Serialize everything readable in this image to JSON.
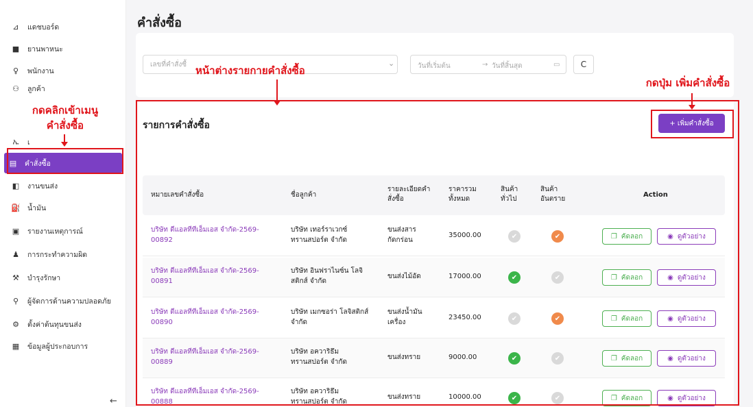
{
  "sidebar": {
    "items": [
      {
        "label": "แดชบอร์ด",
        "icon": "chart-icon"
      },
      {
        "label": "ยานพาหนะ",
        "icon": "truck-icon"
      },
      {
        "label": "พนักงาน",
        "icon": "user-icon"
      },
      {
        "label": "ลูกค้า",
        "icon": "users-icon"
      },
      {
        "label": "เ",
        "icon": "route-icon"
      },
      {
        "label": "คำสั่งซื้อ",
        "icon": "clipboard-icon",
        "active": true
      },
      {
        "label": "งานขนส่ง",
        "icon": "delivery-icon"
      },
      {
        "label": "น้ำมัน",
        "icon": "fuel-icon"
      },
      {
        "label": "รายงานเหตุการณ์",
        "icon": "report-icon"
      },
      {
        "label": "การกระทำความผิด",
        "icon": "offender-icon"
      },
      {
        "label": "บำรุงรักษา",
        "icon": "wrench-icon"
      },
      {
        "label": "ผู้จัดการด้านความปลอดภัย",
        "icon": "safety-manager-icon"
      },
      {
        "label": "ตั้งค่าต้นทุนขนส่ง",
        "icon": "gear-icon"
      },
      {
        "label": "ข้อมูลผู้ประกอบการ",
        "icon": "building-icon"
      }
    ],
    "collapse_glyph": "←"
  },
  "header": {
    "title": "คำสั่งซื้อ"
  },
  "filters": {
    "order_no_placeholder": "เลขที่คำสั่งซื้",
    "start_date_placeholder": "วันที่เริ่มต้น",
    "end_date_placeholder": "วันที่สิ้นสุด",
    "range_arrow": "→",
    "reset_label": "C"
  },
  "list": {
    "title": "รายการคำสั่งซื้อ",
    "add_button": "+ เพิ่มคำสั่งซื้อ",
    "columns": {
      "order_no": "หมายเลขคำสั่งซื้อ",
      "customer": "ชื่อลูกค้า",
      "detail_1": "รายละเอียดคำ",
      "detail_2": "สั่งซื้อ",
      "total_1": "ราคารวม",
      "total_2": "ทั้งหมด",
      "general_1": "สินค้า",
      "general_2": "ทั่วไป",
      "danger_1": "สินค้า",
      "danger_2": "อันตราย",
      "action": "Action"
    },
    "rows": [
      {
        "order_1": "บริษัท ดีแอลทีทีเอ็มเอส จำกัด-2569-",
        "order_2": "00892",
        "cust_1": "บริษัท เทอร์ราเวกซ์",
        "cust_2": "ทรานสปอร์ต จำกัด",
        "det_1": "ขนส่งสาร",
        "det_2": "กัดกร่อน",
        "total": "35000.00",
        "general": "off",
        "danger": "warn"
      },
      {
        "order_1": "บริษัท ดีแอลทีทีเอ็มเอส จำกัด-2569-",
        "order_2": "00891",
        "cust_1": "บริษัท อินฟราไนซ์น โลจิ",
        "cust_2": "สติกส์ จำกัด",
        "det_1": "ขนส่งไม้อัด",
        "det_2": "",
        "total": "17000.00",
        "general": "ok",
        "danger": "off"
      },
      {
        "order_1": "บริษัท ดีแอลทีทีเอ็มเอส จำกัด-2569-",
        "order_2": "00890",
        "cust_1": "บริษัท เมกซอร่า โลจิสติกส์",
        "cust_2": "จำกัด",
        "det_1": "ขนส่งน้ำมัน",
        "det_2": "เครื่อง",
        "total": "23450.00",
        "general": "off",
        "danger": "warn"
      },
      {
        "order_1": "บริษัท ดีแอลทีทีเอ็มเอส จำกัด-2569-",
        "order_2": "00889",
        "cust_1": "บริษัท อควาริธึม",
        "cust_2": "ทรานสปอร์ต จำกัด",
        "det_1": "ขนส่งทราย",
        "det_2": "",
        "total": "9000.00",
        "general": "ok",
        "danger": "off"
      },
      {
        "order_1": "บริษัท ดีแอลทีทีเอ็มเอส จำกัด-2569-",
        "order_2": "00888",
        "cust_1": "บริษัท อควาริธึม",
        "cust_2": "ทรานสปอร์ต จำกัด",
        "det_1": "ขนส่งทราย",
        "det_2": "",
        "total": "10000.00",
        "general": "ok",
        "danger": "off"
      }
    ],
    "copy_label": "คัดลอก",
    "view_label": "ดูตัวอย่าง"
  },
  "annotations": {
    "menu_hint_1": "กดคลิกเข้าเมนู",
    "menu_hint_2": "คำสั่งซื้อ",
    "window_hint": "หน้าต่างรายกายคำสั่งซื้อ",
    "add_hint": "กดปุ่ม เพิ่มคำสั่งซื้อ"
  },
  "colors": {
    "accent": "#7b3fc4",
    "annotation": "#e0151b",
    "ok": "#3bb54a",
    "warn": "#f08a4b"
  }
}
